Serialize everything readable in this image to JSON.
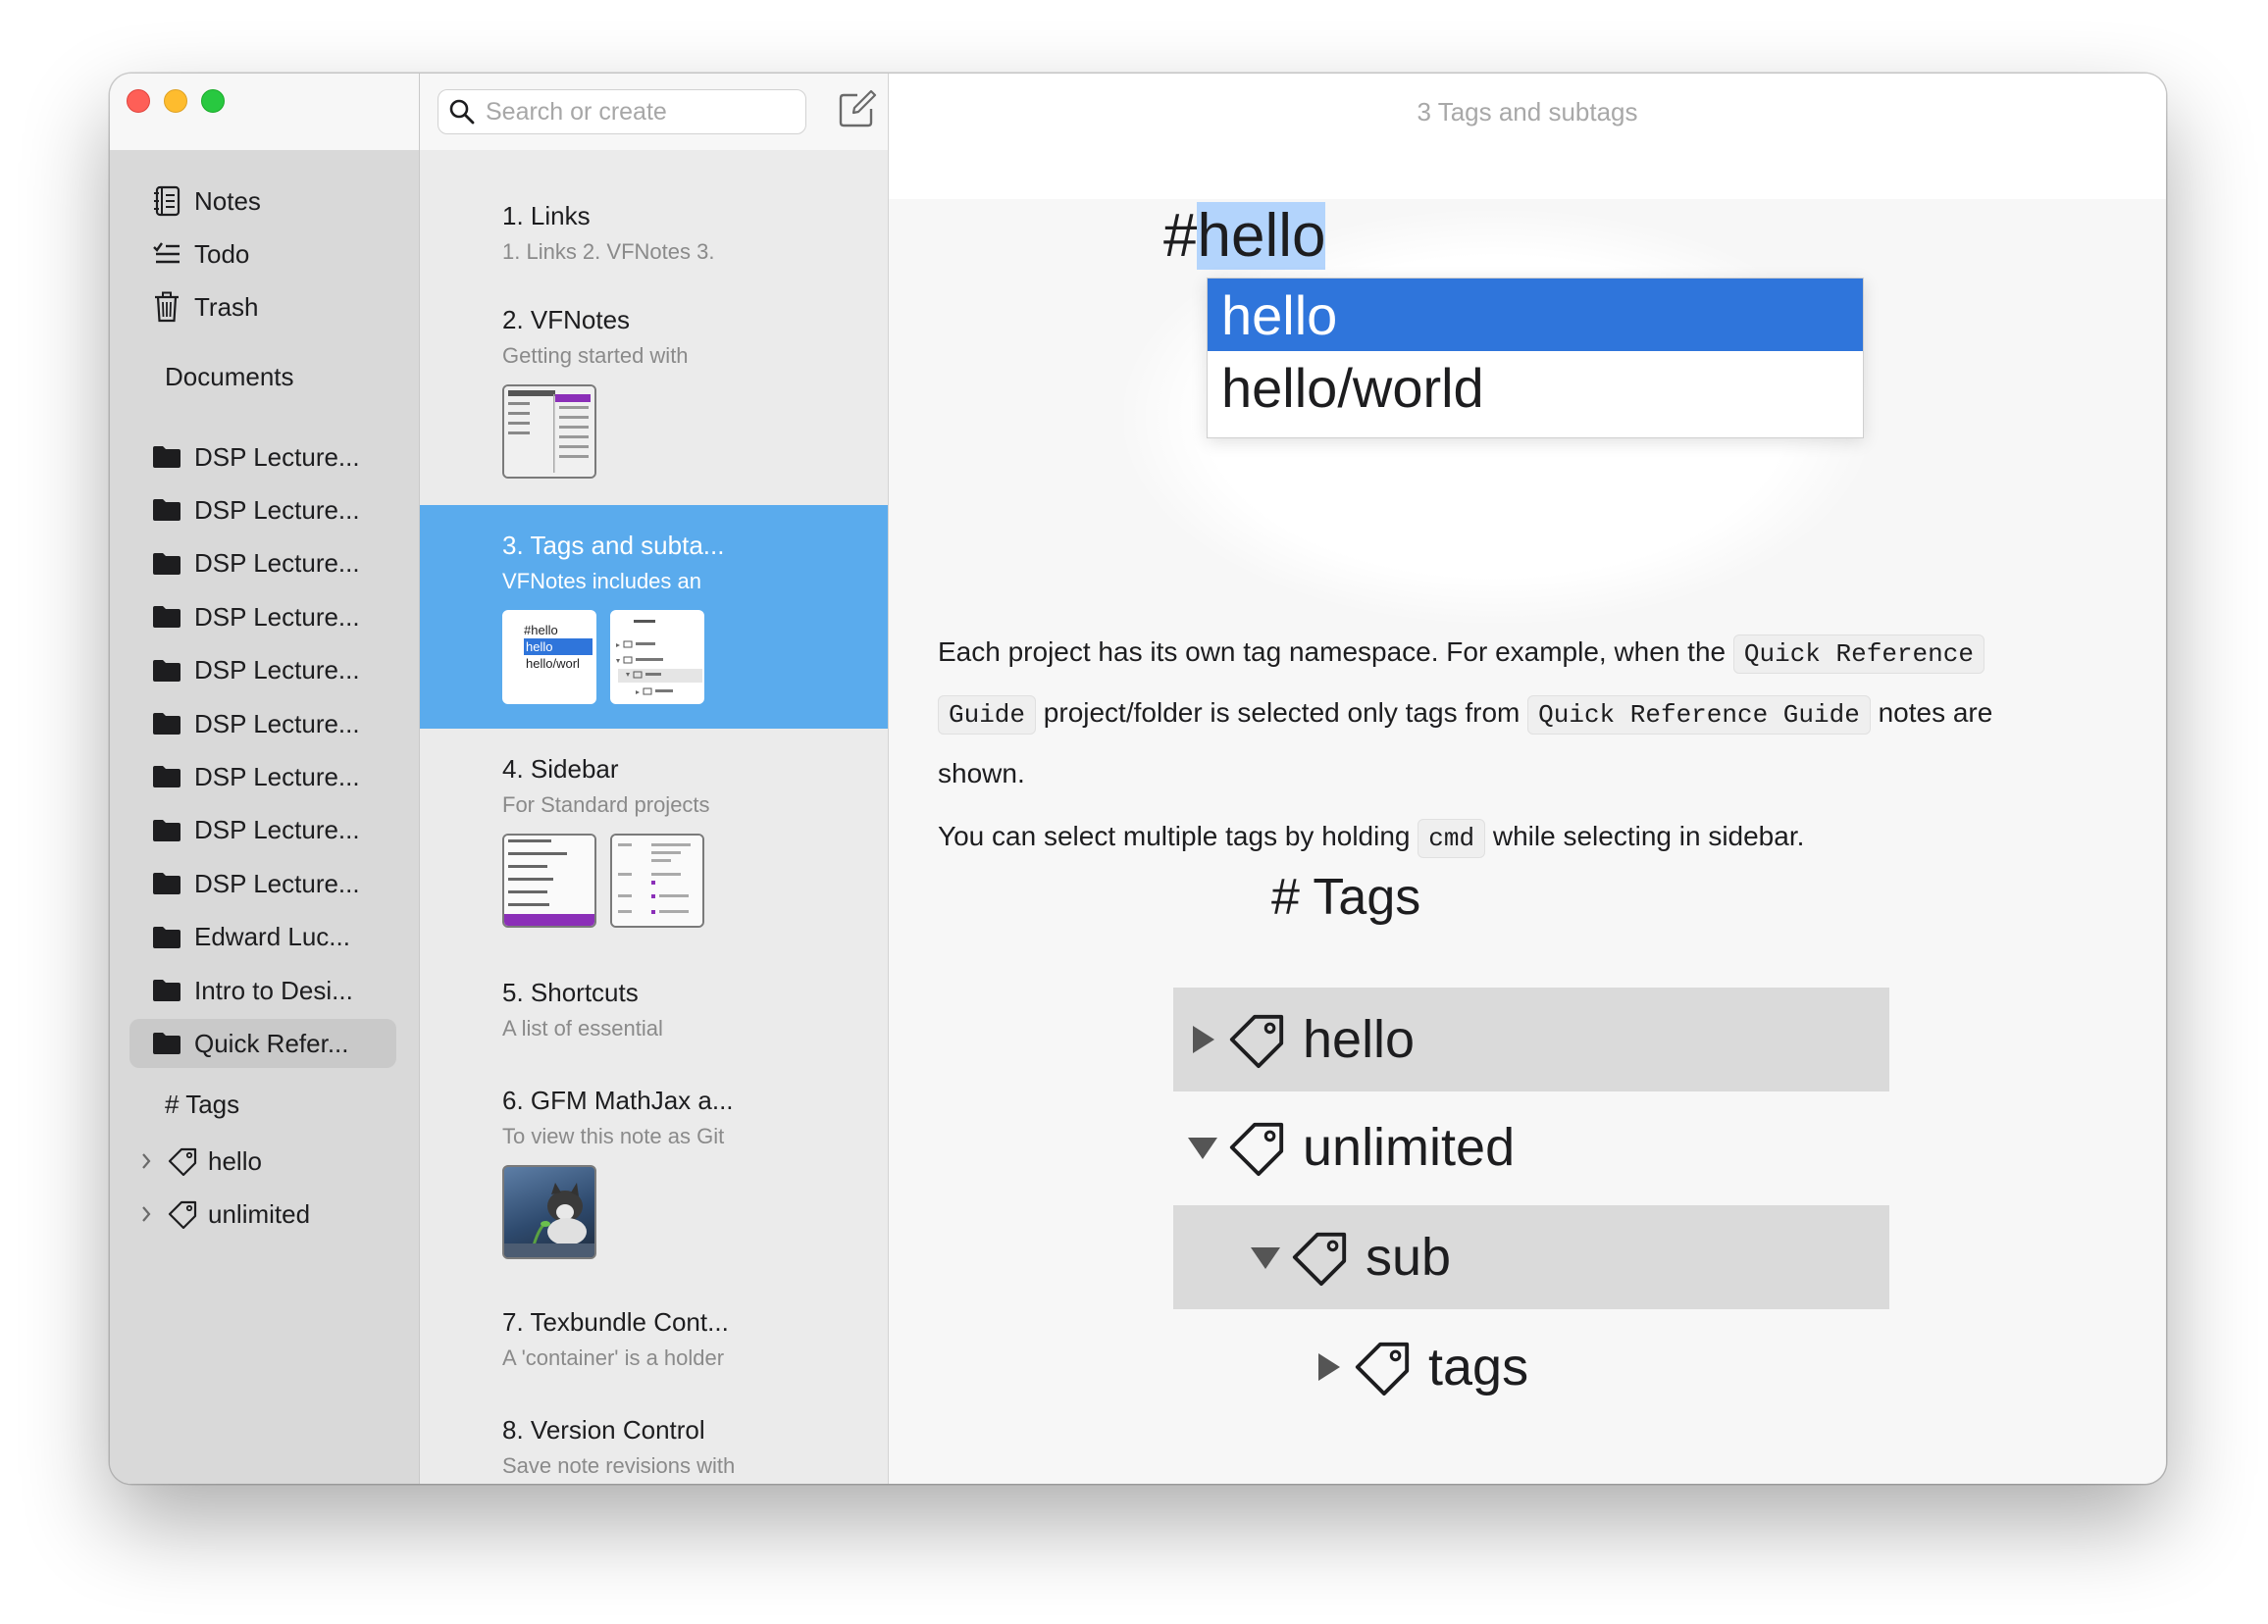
{
  "sidebar": {
    "nav": [
      {
        "label": "Notes",
        "icon": "notebook-icon"
      },
      {
        "label": "Todo",
        "icon": "checklist-icon"
      },
      {
        "label": "Trash",
        "icon": "trash-icon"
      }
    ],
    "documents_title": "Documents",
    "folders": [
      "DSP Lecture...",
      "DSP Lecture...",
      "DSP Lecture...",
      "DSP Lecture...",
      "DSP Lecture...",
      "DSP Lecture...",
      "DSP Lecture...",
      "DSP Lecture...",
      "DSP Lecture...",
      "Edward Luc...",
      "Intro to Desi...",
      "Quick Refer..."
    ],
    "selected_folder_index": 11,
    "tags_title": "# Tags",
    "tags": [
      "hello",
      "unlimited"
    ]
  },
  "notelist": {
    "search_placeholder": "Search or create",
    "notes": [
      {
        "title": "1. Links",
        "preview": "1. Links 2. VFNotes 3."
      },
      {
        "title": "2. VFNotes",
        "preview": "Getting started with"
      },
      {
        "title": "3. Tags and subta...",
        "preview": "VFNotes includes an"
      },
      {
        "title": "4. Sidebar",
        "preview": "For Standard projects"
      },
      {
        "title": "5. Shortcuts",
        "preview": "A list of essential"
      },
      {
        "title": "6. GFM MathJax a...",
        "preview": "To view this note as Git"
      },
      {
        "title": "7. Texbundle Cont...",
        "preview": "A 'container' is a holder"
      },
      {
        "title": "8. Version Control",
        "preview": "Save note revisions with"
      }
    ],
    "selected_index": 2,
    "thumb_text": {
      "hashtag": "#hello",
      "opt1": "hello",
      "opt2": "hello/worl"
    }
  },
  "editor": {
    "title": "3 Tags and subtags",
    "hero": {
      "prefix": "#",
      "selected": "hello",
      "suggestions": [
        "hello",
        "hello/world"
      ]
    },
    "para1": {
      "t1": "Each project has its own tag namespace. For example, when the ",
      "c1": "Quick Reference",
      "c2": "Guide",
      "t2": " project/folder is selected only tags from ",
      "c3": "Quick Reference Guide",
      "t3": " notes are",
      "t4": "shown."
    },
    "para2": {
      "t1": "You can select multiple tags by holding ",
      "c1": "cmd",
      "t2": " while selecting in sidebar."
    },
    "tags_heading": "# Tags",
    "tree": [
      {
        "label": "hello",
        "state": "collapsed"
      },
      {
        "label": "unlimited",
        "state": "expanded"
      },
      {
        "label": "sub",
        "state": "expanded"
      },
      {
        "label": "tags",
        "state": "collapsed"
      }
    ]
  }
}
